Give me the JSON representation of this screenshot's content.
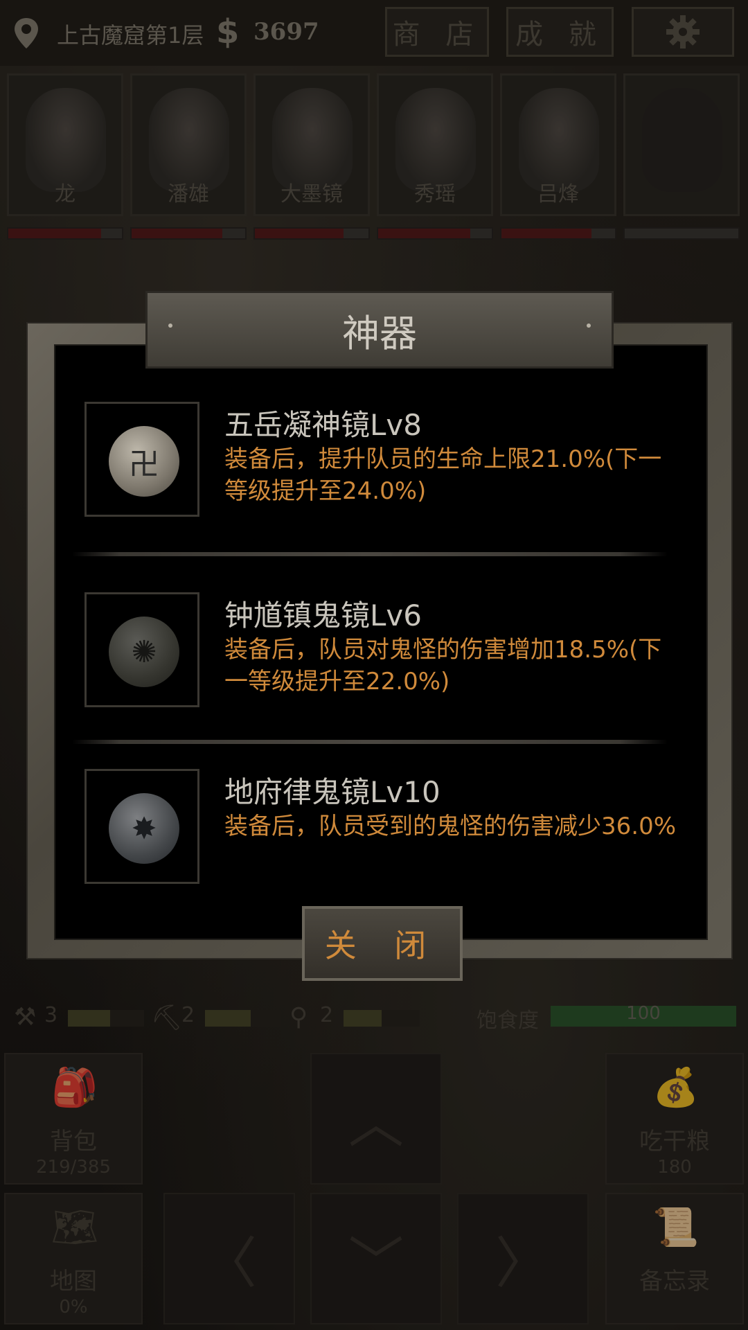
{
  "topbar": {
    "location": "上古魔窟第1层",
    "money_symbol": "$",
    "money": "3697",
    "shop_label": "商 店",
    "achievements_label": "成 就",
    "settings_icon": "gear-icon"
  },
  "team": [
    {
      "name": "龙",
      "hp": 0.82
    },
    {
      "name": "潘雄",
      "hp": 0.8
    },
    {
      "name": "大墨镜",
      "hp": 0.78
    },
    {
      "name": "秀瑶",
      "hp": 0.81
    },
    {
      "name": "吕烽",
      "hp": 0.79
    },
    {
      "name": "",
      "hp": 0
    }
  ],
  "modal": {
    "title": "神器",
    "close_label": "关 闭",
    "artifacts": [
      {
        "name": "五岳凝神镜Lv8",
        "desc": "装备后，提升队员的生命上限21.0%(下一等级提升至24.0%)",
        "icon": "mirror-icon"
      },
      {
        "name": "钟馗镇鬼镜Lv6",
        "desc": "装备后，队员对鬼怪的伤害增加18.5%(下一等级提升至22.0%)",
        "icon": "mirror-icon"
      },
      {
        "name": "地府律鬼镜Lv10",
        "desc": "装备后，队员受到的鬼怪的伤害减少36.0%",
        "icon": "mirror-icon"
      }
    ]
  },
  "status": {
    "tool1": {
      "icon": "axe-icon",
      "count": "3"
    },
    "tool2": {
      "icon": "pickaxe-icon",
      "count": "2"
    },
    "tool3": {
      "icon": "shovel-icon",
      "count": "2"
    },
    "satiety_label": "饱食度",
    "satiety_value": "100"
  },
  "controls": {
    "bag_label": "背包",
    "bag_count": "219/385",
    "food_label": "吃干粮",
    "food_count": "180",
    "map_label": "地图",
    "map_pct": "0%",
    "memo_label": "备忘录"
  },
  "colors": {
    "accent": "#d08a3b",
    "title_text": "#cfcac0"
  }
}
